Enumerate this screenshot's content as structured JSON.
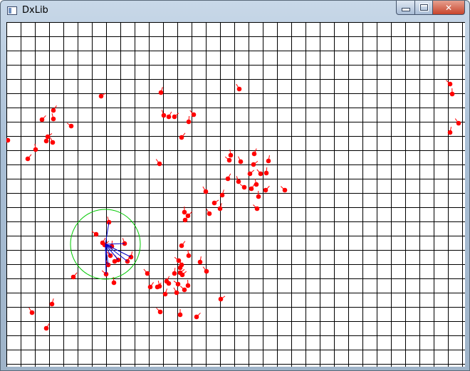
{
  "window": {
    "title": "DxLib",
    "controls": {
      "minimize": "",
      "maximize": "",
      "close": "✕"
    }
  },
  "scene": {
    "grid_color": "#000000",
    "agent_color": "#ff0000",
    "selection_circle_color": "#00c800",
    "neighbor_line_color": "#0000c8",
    "agent_count": 98
  }
}
